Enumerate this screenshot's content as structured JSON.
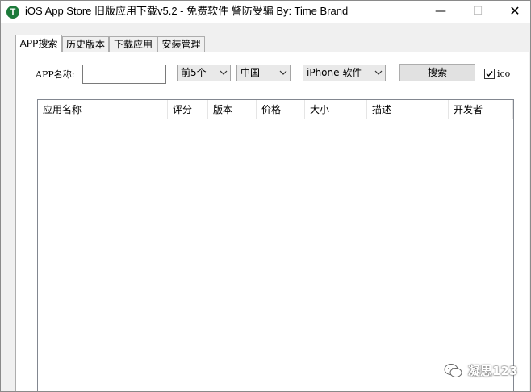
{
  "window": {
    "title": "iOS App Store 旧版应用下载v5.2 - 免费软件 警防受骗 By: Time Brand",
    "icon_letter": "T",
    "minimize_glyph": "—",
    "maximize_glyph": "☐",
    "close_glyph": "✕"
  },
  "tabs": [
    {
      "label": "APP搜索",
      "active": true
    },
    {
      "label": "历史版本",
      "active": false
    },
    {
      "label": "下载应用",
      "active": false
    },
    {
      "label": "安装管理",
      "active": false
    }
  ],
  "search": {
    "name_label": "APP名称:",
    "name_value": "",
    "count_select": "前5个",
    "region_select": "中国",
    "device_select": "iPhone 软件",
    "search_button": "搜索",
    "ico_checkbox_label": "ico",
    "ico_checked": true
  },
  "results_table": {
    "columns": [
      "应用名称",
      "评分",
      "版本",
      "价格",
      "大小",
      "描述",
      "开发者"
    ],
    "rows": []
  },
  "watermark": {
    "text": "凝思123"
  }
}
